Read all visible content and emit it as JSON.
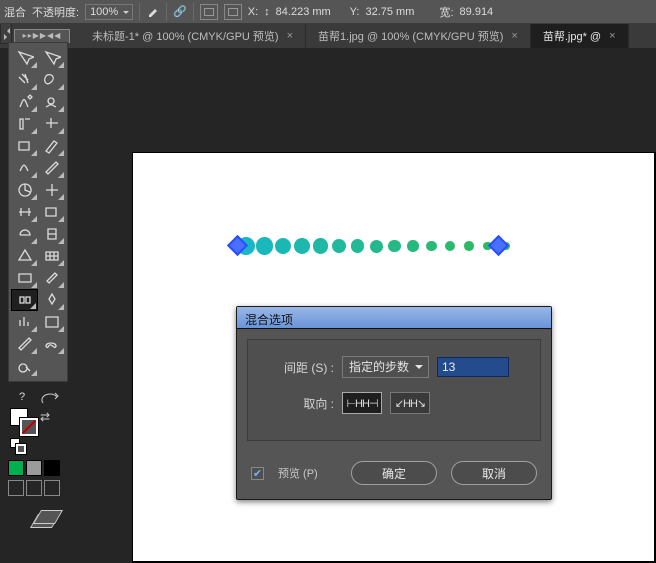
{
  "optbar": {
    "blend_label_left": "混合",
    "opacity_label": "不透明度:",
    "opacity_value": "100%",
    "x_label": "X:",
    "x_value": "84.223 mm",
    "y_label": "Y:",
    "y_value": "32.75 mm",
    "w_label": "宽:",
    "w_value": "89.914"
  },
  "tabs": [
    {
      "label": "未标题-1* @ 100% (CMYK/GPU 预览)",
      "active": false
    },
    {
      "label": "苗帮1.jpg @ 100% (CMYK/GPU 预览)",
      "active": false
    },
    {
      "label": "苗帮.jpg* @",
      "active": true
    }
  ],
  "tools": {
    "panel_tab_text": "▸▸▶▶◀◀",
    "help_label": "?",
    "names": [
      [
        "selection",
        "direct-selection"
      ],
      [
        "magic-wand",
        "lasso"
      ],
      [
        "pen",
        "curvature-pen"
      ],
      [
        "type",
        "line-segment"
      ],
      [
        "rectangle",
        "paintbrush"
      ],
      [
        "shaper",
        "eraser"
      ],
      [
        "rotate",
        "scale"
      ],
      [
        "width",
        "free-transform"
      ],
      [
        "shape-builder",
        "puppet-warp"
      ],
      [
        "perspective-grid",
        "mesh"
      ],
      [
        "gradient",
        "eyedropper"
      ],
      [
        "blend",
        "symbol-sprayer"
      ],
      [
        "column-graph",
        "artboard"
      ],
      [
        "slice",
        "hand"
      ],
      [
        "zoom",
        ""
      ]
    ],
    "selected_row": 11,
    "selected_col": 0
  },
  "swatches": {
    "fill_hex": "#ffffff",
    "stroke_is_none": true,
    "colors": [
      "#00b050",
      "#9b9b9b",
      "#000000"
    ]
  },
  "canvas": {
    "blend_steps_visible": 13,
    "colors_from_to": [
      "#17b8c4",
      "#2fba58"
    ],
    "handle_hex": "#4a6eff"
  },
  "dialog": {
    "title": "混合选项",
    "spacing_label": "间距 (S) :",
    "spacing_value": "指定的步数",
    "steps_value": "13",
    "orient_label": "取向 :",
    "preview_label": "预览 (P)",
    "preview_on": true,
    "ok_label": "确定",
    "cancel_label": "取消"
  }
}
